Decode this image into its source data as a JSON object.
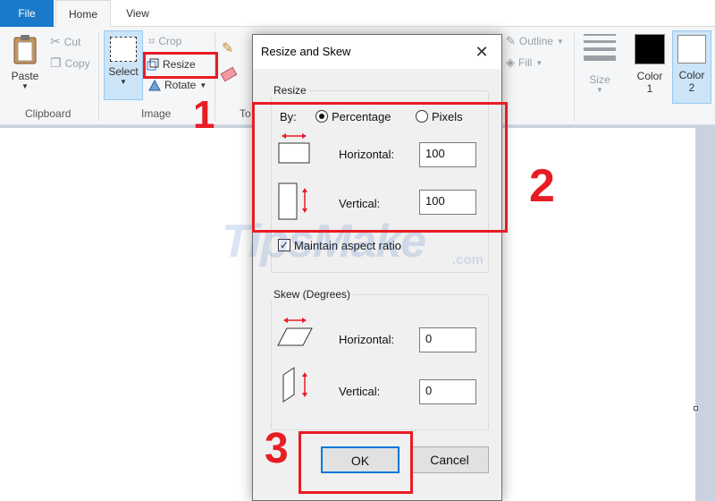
{
  "tabs": {
    "file": "File",
    "home": "Home",
    "view": "View"
  },
  "ribbon": {
    "clipboard": {
      "paste": "Paste",
      "cut": "Cut",
      "copy": "Copy",
      "group_label": "Clipboard"
    },
    "image": {
      "select": "Select",
      "crop": "Crop",
      "resize": "Resize",
      "rotate": "Rotate",
      "group_label": "Image"
    },
    "tools": {
      "group_label": "To"
    },
    "shapes": {
      "outline": "Outline",
      "fill": "Fill"
    },
    "size": {
      "label": "Size"
    },
    "colors": {
      "color1_label": "Color",
      "color1_num": "1",
      "color2_label": "Color",
      "color2_num": "2",
      "color1_value": "#000000",
      "color2_value": "#ffffff"
    }
  },
  "dialog": {
    "title": "Resize and Skew",
    "resize": {
      "legend": "Resize",
      "by_label": "By:",
      "percentage_label": "Percentage",
      "pixels_label": "Pixels",
      "selected_mode": "percentage",
      "horizontal_label": "Horizontal:",
      "horizontal_value": "100",
      "vertical_label": "Vertical:",
      "vertical_value": "100",
      "maintain_aspect_label": "Maintain aspect ratio",
      "maintain_aspect_checked": true
    },
    "skew": {
      "legend": "Skew (Degrees)",
      "horizontal_label": "Horizontal:",
      "horizontal_value": "0",
      "vertical_label": "Vertical:",
      "vertical_value": "0"
    },
    "ok_label": "OK",
    "cancel_label": "Cancel"
  },
  "annotations": {
    "step1": "1",
    "step2": "2",
    "step3": "3",
    "color": "#e81c24"
  },
  "watermark": {
    "text": "TipsMake",
    "suffix": ".com"
  },
  "colors": {
    "accent": "#1979ca",
    "canvas_bg": "#c9d3e0"
  }
}
